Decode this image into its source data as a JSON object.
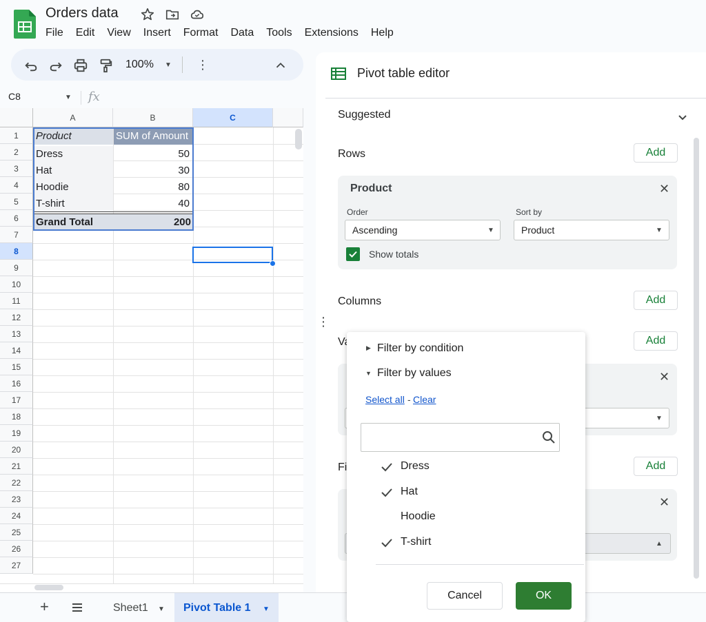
{
  "app": {
    "title": "Orders data",
    "menu": [
      "File",
      "Edit",
      "View",
      "Insert",
      "Format",
      "Data",
      "Tools",
      "Extensions",
      "Help"
    ]
  },
  "toolbar": {
    "zoom": "100%"
  },
  "formula_bar": {
    "cell_ref": "C8",
    "fx": "fx"
  },
  "grid": {
    "columns": [
      "A",
      "B",
      "C"
    ],
    "rows": [
      "1",
      "2",
      "3",
      "4",
      "5",
      "6",
      "7",
      "8",
      "9",
      "10",
      "11",
      "12",
      "13",
      "14",
      "15",
      "16",
      "17",
      "18",
      "19",
      "20",
      "21",
      "22",
      "23",
      "24",
      "25",
      "26",
      "27"
    ],
    "header": {
      "a": "Product",
      "b": "SUM of Amount"
    },
    "data": [
      {
        "product": "Dress",
        "amount": "50"
      },
      {
        "product": "Hat",
        "amount": "30"
      },
      {
        "product": "Hoodie",
        "amount": "80"
      },
      {
        "product": "T-shirt",
        "amount": "40"
      }
    ],
    "total": {
      "label": "Grand Total",
      "value": "200"
    }
  },
  "sheets": {
    "tab1": "Sheet1",
    "tab2": "Pivot Table 1"
  },
  "panel": {
    "title": "Pivot table editor",
    "suggested": "Suggested",
    "rows_label": "Rows",
    "columns_label": "Columns",
    "values_label_partial": "Va",
    "filters_label_partial": "Fi",
    "add": "Add",
    "row_card": {
      "title": "Product",
      "order_label": "Order",
      "order_value": "Ascending",
      "sortby_label": "Sort by",
      "sortby_value": "Product",
      "show_totals": "Show totals"
    }
  },
  "filter_popup": {
    "by_condition": "Filter by condition",
    "by_values": "Filter by values",
    "select_all": "Select all",
    "sep": "-",
    "clear": "Clear",
    "search_placeholder": "",
    "items": [
      {
        "label": "Dress",
        "checked": true
      },
      {
        "label": "Hat",
        "checked": true
      },
      {
        "label": "Hoodie",
        "checked": false
      },
      {
        "label": "T-shirt",
        "checked": true
      }
    ],
    "cancel": "Cancel",
    "ok": "OK"
  },
  "colors": {
    "accent_green": "#188038",
    "ok_green": "#2e7d32",
    "selection_blue": "#1a73e8",
    "link_blue": "#1155cc"
  }
}
